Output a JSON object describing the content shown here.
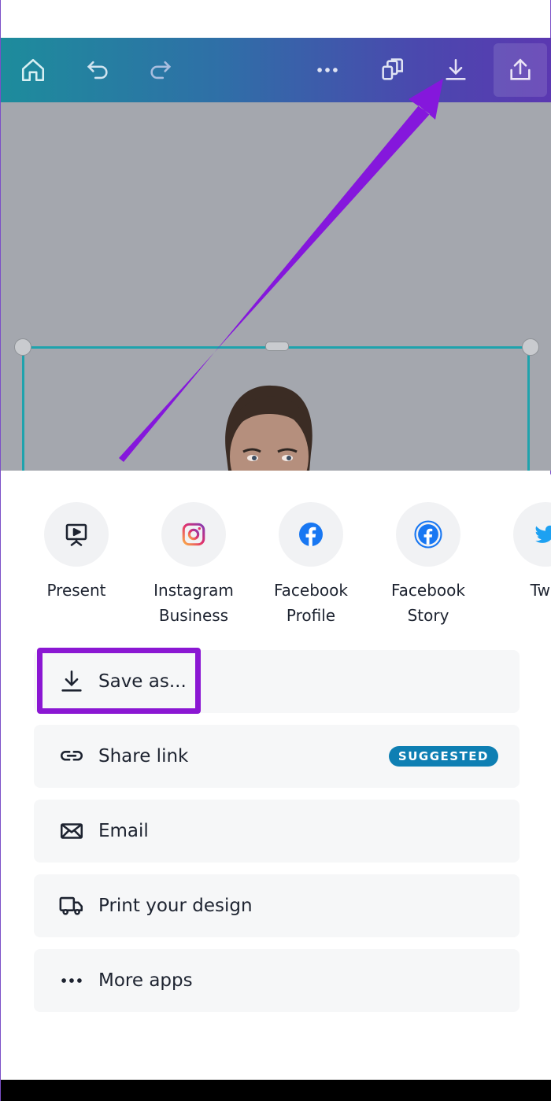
{
  "toolbar": {
    "icons": [
      "home-icon",
      "undo-icon",
      "redo-icon",
      "more-icon",
      "copy-icon",
      "download-icon",
      "share-icon"
    ]
  },
  "share_targets": [
    {
      "label": "Present",
      "icon": "present-icon"
    },
    {
      "label": "Instagram\nBusiness",
      "icon": "instagram-icon"
    },
    {
      "label": "Facebook\nProfile",
      "icon": "facebook-icon"
    },
    {
      "label": "Facebook\nStory",
      "icon": "facebook-story-icon"
    },
    {
      "label": "Twit",
      "icon": "twitter-icon"
    }
  ],
  "options": {
    "save": {
      "label": "Save as..."
    },
    "share_link": {
      "label": "Share link",
      "badge": "SUGGESTED"
    },
    "email": {
      "label": "Email"
    },
    "print": {
      "label": "Print your design"
    },
    "more": {
      "label": "More apps"
    }
  },
  "colors": {
    "accent": "#8b17d3",
    "badge": "#0e7fb3",
    "instagram": "#e1306c",
    "facebook": "#1877f2",
    "twitter": "#1da1f2"
  }
}
